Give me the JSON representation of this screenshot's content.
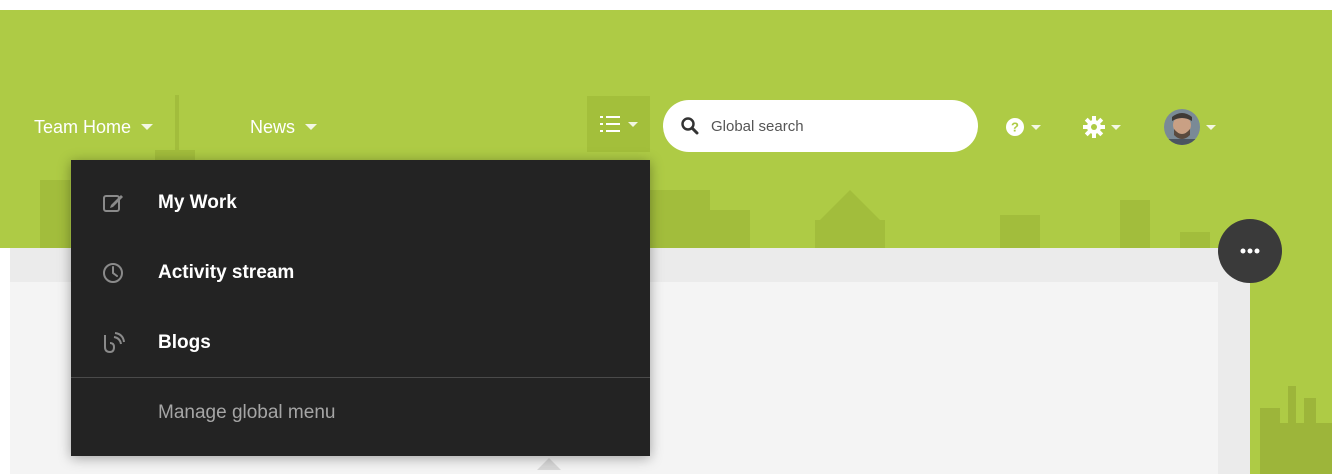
{
  "nav": {
    "team_home": "Team Home",
    "news": "News"
  },
  "search": {
    "placeholder": "Global search"
  },
  "global_menu": {
    "items": [
      {
        "label": "My Work",
        "icon": "edit-icon"
      },
      {
        "label": "Activity stream",
        "icon": "clock-icon"
      },
      {
        "label": "Blogs",
        "icon": "rss-feed-icon"
      }
    ],
    "manage_label": "Manage global menu"
  },
  "header_icons": {
    "menu": "list-icon",
    "help": "help-circle-icon",
    "settings": "gear-icon",
    "user": "avatar"
  },
  "colors": {
    "header_green": "#aecb45",
    "menu_background": "#232323",
    "more_button": "#3a3a3a"
  }
}
